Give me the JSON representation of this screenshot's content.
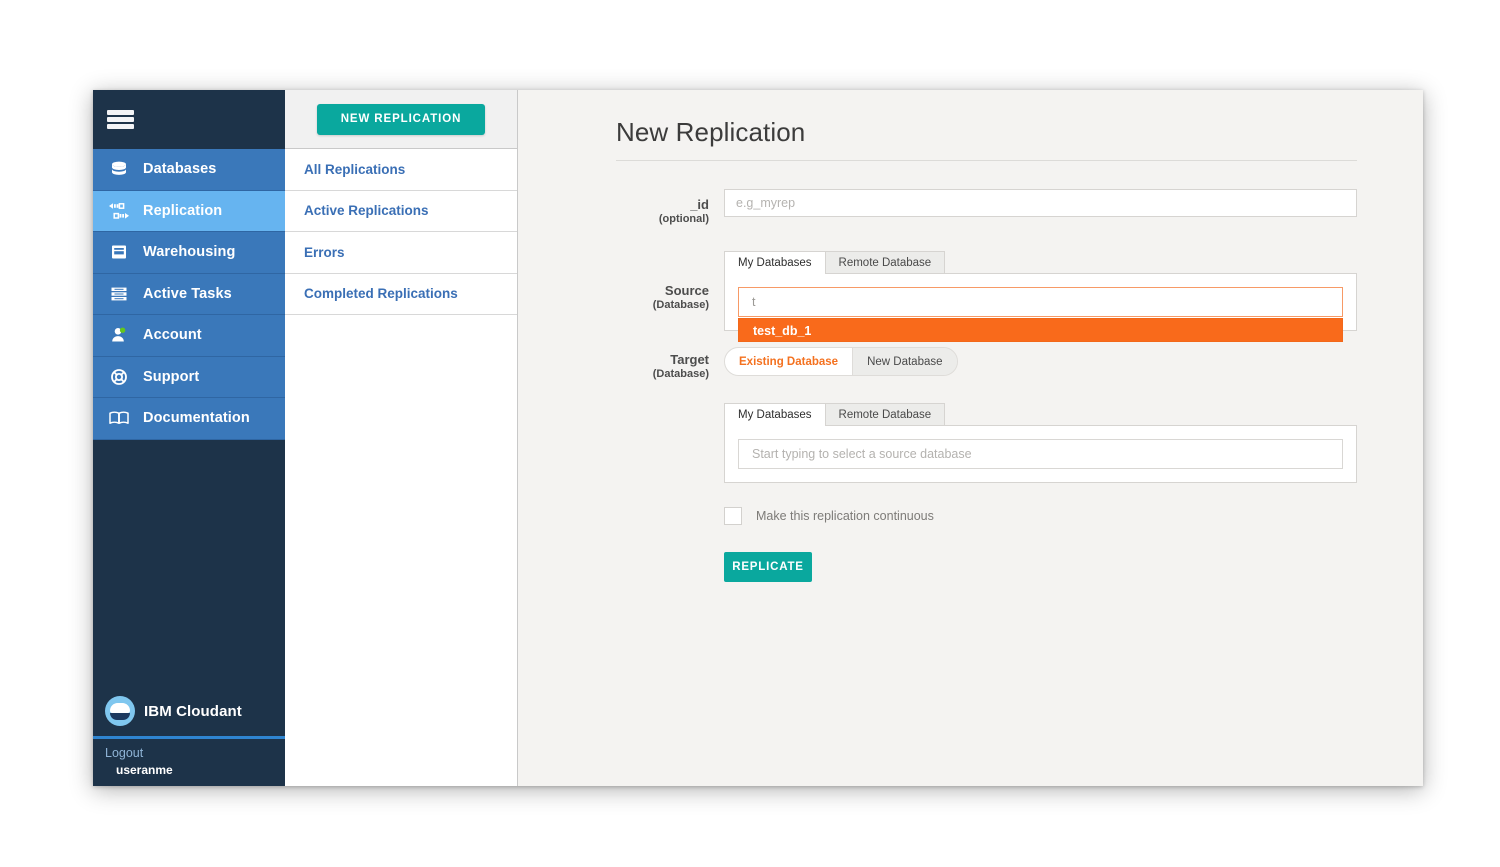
{
  "app": {
    "brand_ibm": "IBM ",
    "brand_name": "Cloudant"
  },
  "primary_nav": {
    "menu_icon": "hamburger-icon",
    "items": [
      {
        "label": "Databases",
        "icon": "database-stack-icon",
        "active": false
      },
      {
        "label": "Replication",
        "icon": "replication-arrows-icon",
        "active": true
      },
      {
        "label": "Warehousing",
        "icon": "warehouse-icon",
        "active": false
      },
      {
        "label": "Active Tasks",
        "icon": "tasks-list-icon",
        "active": false
      },
      {
        "label": "Account",
        "icon": "account-person-icon",
        "active": false
      },
      {
        "label": "Support",
        "icon": "lifebuoy-icon",
        "active": false
      },
      {
        "label": "Documentation",
        "icon": "book-icon",
        "active": false
      }
    ]
  },
  "account": {
    "logout_label": "Logout",
    "username": "useranme"
  },
  "secondary_panel": {
    "new_replication_button": "NEW REPLICATION",
    "links": [
      {
        "label": "All Replications"
      },
      {
        "label": "Active Replications"
      },
      {
        "label": "Errors"
      },
      {
        "label": "Completed Replications"
      }
    ]
  },
  "main": {
    "page_title": "New Replication",
    "id_field": {
      "label_main": "_id",
      "label_sub": "(optional)",
      "placeholder": "e.g_myrep",
      "value": ""
    },
    "source": {
      "label_main": "Source",
      "label_sub": "(Database)",
      "tabs": [
        {
          "label": "My Databases",
          "active": true
        },
        {
          "label": "Remote Database",
          "active": false
        }
      ],
      "input_value": "t",
      "input_placeholder": "Start typing to select a source database",
      "suggestions": [
        {
          "label": "test_db_1",
          "highlighted": true
        }
      ]
    },
    "target": {
      "label_main": "Target",
      "label_sub": "(Database)",
      "modes": [
        {
          "label": "Existing Database",
          "active": true
        },
        {
          "label": "New Database",
          "active": false
        }
      ],
      "tabs": [
        {
          "label": "My Databases",
          "active": true
        },
        {
          "label": "Remote Database",
          "active": false
        }
      ],
      "input_value": "",
      "input_placeholder": "Start typing to select a source database"
    },
    "continuous": {
      "checked": false,
      "label": "Make this replication continuous"
    },
    "replicate_button": "REPLICATE"
  },
  "colors": {
    "nav_dark": "#1d3349",
    "nav_blue": "#3a78ba",
    "nav_active": "#66b4f0",
    "teal_accent": "#0aa89e",
    "orange_accent": "#f96a1b",
    "link_blue": "#3a6fb5",
    "page_bg": "#f4f3f1"
  }
}
